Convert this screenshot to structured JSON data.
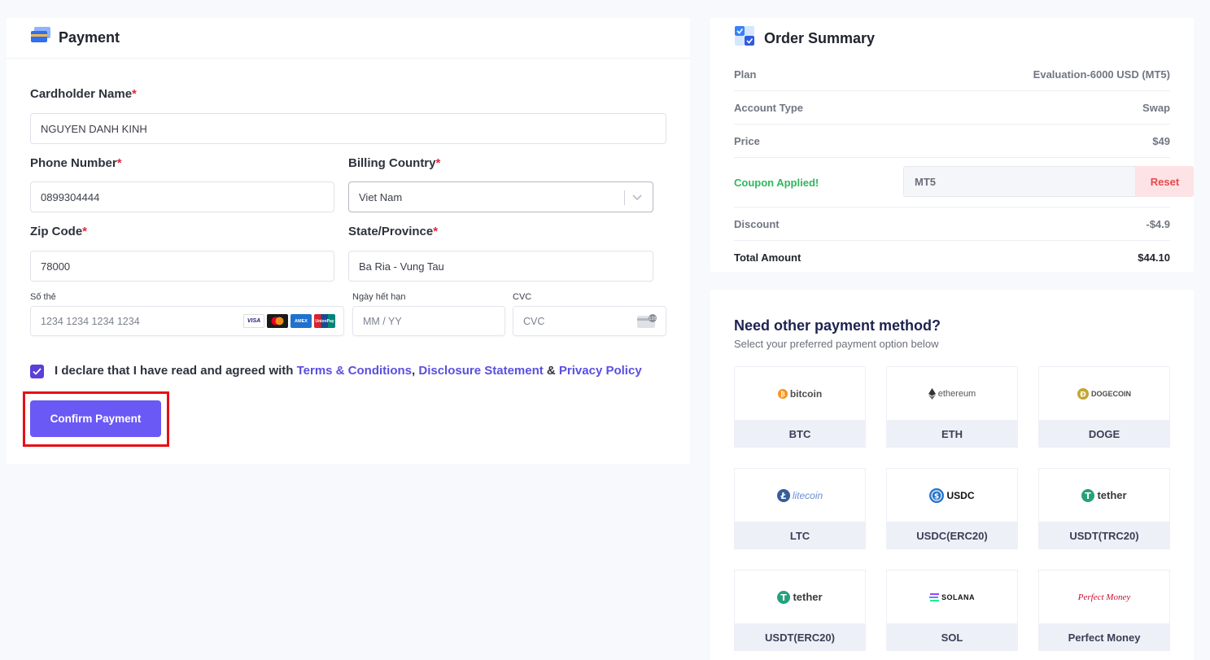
{
  "payment": {
    "title": "Payment",
    "cardholder_label": "Cardholder Name",
    "cardholder_value": "NGUYEN DANH KINH",
    "phone_label": "Phone Number",
    "phone_value": "0899304444",
    "country_label": "Billing Country",
    "country_value": "Viet Nam",
    "zip_label": "Zip Code",
    "zip_value": "78000",
    "state_label": "State/Province",
    "state_value": "Ba Ria - Vung Tau",
    "required_mark": "*",
    "card_number_label": "Số thẻ",
    "card_number_placeholder": "1234 1234 1234 1234",
    "expiry_label": "Ngày hết hạn",
    "expiry_placeholder": "MM / YY",
    "cvc_label": "CVC",
    "cvc_placeholder": "CVC",
    "cvc_badge": "135",
    "card_brands": [
      "VISA",
      "AMEX",
      "UnionPay"
    ],
    "declare_text": "I declare that I have read and agreed with ",
    "terms_link": "Terms & Conditions",
    "comma": ", ",
    "disclosure_link": "Disclosure Statement",
    "amp": " & ",
    "privacy_link": "Privacy Policy",
    "agreed": true,
    "confirm_label": "Confirm Payment",
    "accent_color": "#6a59f5"
  },
  "summary": {
    "title": "Order Summary",
    "rows": [
      {
        "key": "Plan",
        "value": "Evaluation-6000 USD (MT5)"
      },
      {
        "key": "Account Type",
        "value": "Swap"
      },
      {
        "key": "Price",
        "value": "$49"
      }
    ],
    "coupon_label": "Coupon Applied!",
    "coupon_code": "MT5",
    "reset_label": "Reset",
    "discount_key": "Discount",
    "discount_value": "-$4.9",
    "total_key": "Total Amount",
    "total_value": "$44.10"
  },
  "methods": {
    "title": "Need other payment method?",
    "subtitle": "Select your preferred payment option below",
    "items": [
      {
        "name": "BTC",
        "logo": "bitcoin"
      },
      {
        "name": "ETH",
        "logo": "ethereum"
      },
      {
        "name": "DOGE",
        "logo": "DOGECOIN"
      },
      {
        "name": "LTC",
        "logo": "litecoin"
      },
      {
        "name": "USDC(ERC20)",
        "logo": "USDC"
      },
      {
        "name": "USDT(TRC20)",
        "logo": "tether"
      },
      {
        "name": "USDT(ERC20)",
        "logo": "tether"
      },
      {
        "name": "SOL",
        "logo": "SOLANA"
      },
      {
        "name": "Perfect Money",
        "logo": "Perfect Money"
      }
    ]
  }
}
